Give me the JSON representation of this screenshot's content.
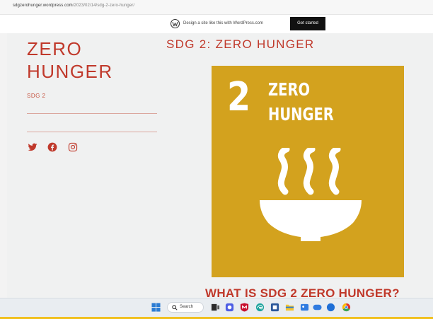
{
  "browser": {
    "url_host": "sdgzerohunger.wordpress.com",
    "url_path": "/2023/02/14/sdg-2-zero-hunger/"
  },
  "wp_banner": {
    "text": "Design a site like this with WordPress.com",
    "cta_label": "Get started"
  },
  "site": {
    "title": "ZERO HUNGER",
    "tagline": "SDG 2",
    "social": [
      "twitter-icon",
      "facebook-icon",
      "instagram-icon"
    ]
  },
  "post": {
    "title": "SDG 2: ZERO HUNGER",
    "tile": {
      "number": "2",
      "label_line1": "ZERO",
      "label_line2": "HUNGER",
      "color": "#d3a21e"
    },
    "section_heading": "WHAT IS SDG 2 ZERO HUNGER?"
  },
  "taskbar": {
    "search_label": "Search",
    "icons": [
      "windows-start-icon",
      "search-icon",
      "file-explorer-icon",
      "chat-icon",
      "mcafee-icon",
      "edge-icon",
      "word-icon",
      "folder-icon",
      "photos-icon",
      "mail-icon",
      "chrome-icon"
    ]
  },
  "colors": {
    "accent": "#c0392b",
    "tile": "#d3a21e",
    "taskbar_accent": "#f0c020"
  }
}
